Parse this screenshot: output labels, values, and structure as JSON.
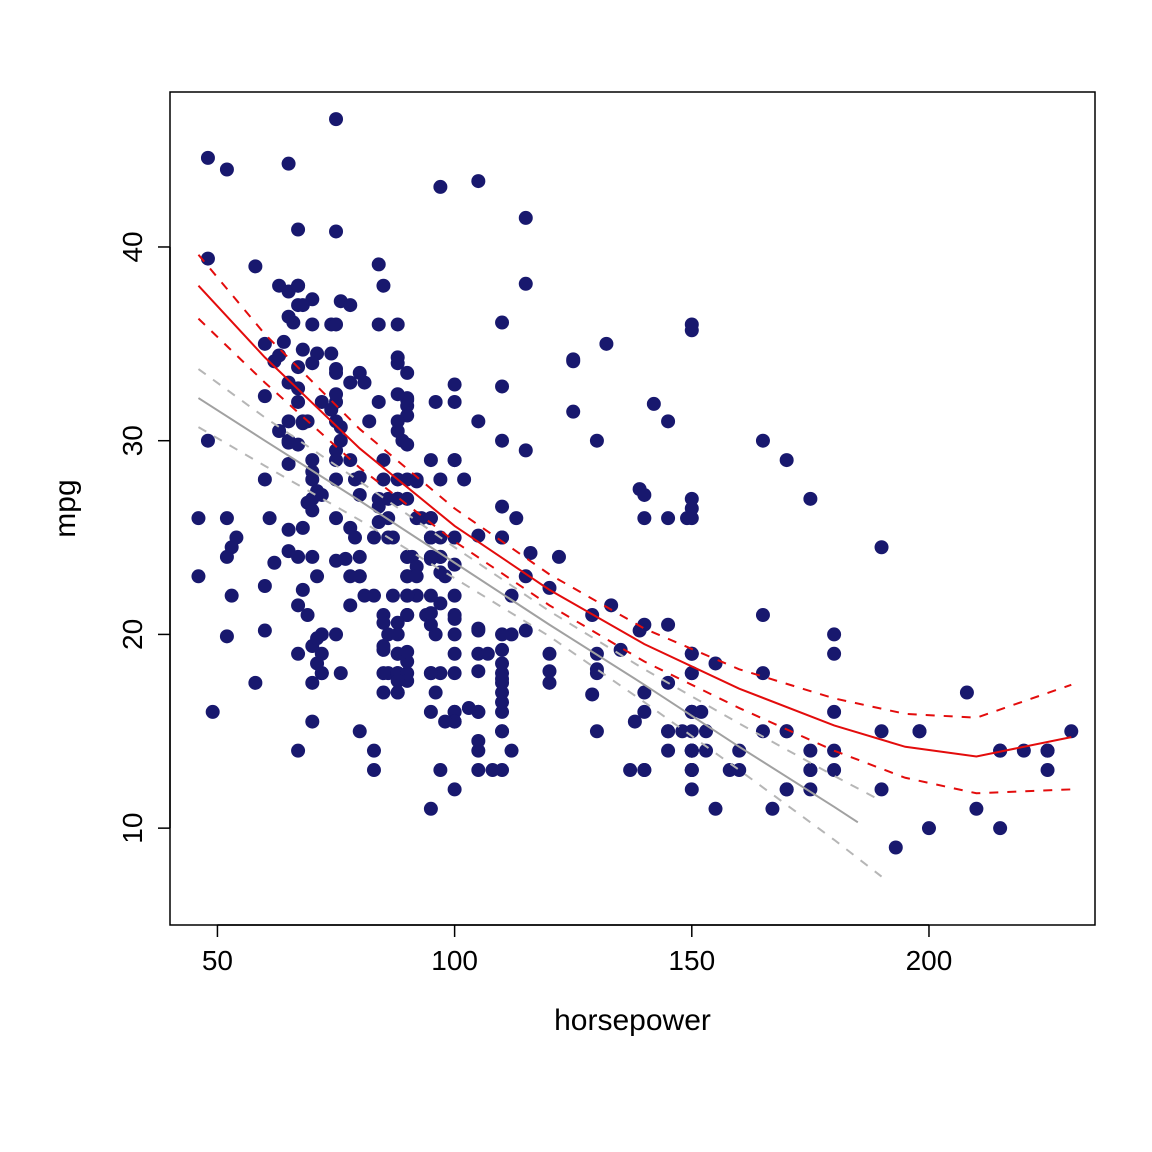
{
  "chart_data": {
    "type": "scatter",
    "title": "",
    "xlabel": "horsepower",
    "ylabel": "mpg",
    "xlim": [
      40,
      235
    ],
    "ylim": [
      5,
      48
    ],
    "x_ticks": [
      50,
      100,
      150,
      200
    ],
    "y_ticks": [
      10,
      20,
      30,
      40
    ],
    "point_color": "#18186e",
    "point_radius": 7,
    "scatter": {
      "x": [
        130,
        165,
        150,
        150,
        140,
        198,
        220,
        215,
        225,
        190,
        170,
        160,
        150,
        225,
        95,
        95,
        97,
        85,
        88,
        46,
        87,
        90,
        95,
        113,
        90,
        215,
        200,
        210,
        193,
        88,
        90,
        95,
        100,
        105,
        100,
        88,
        100,
        165,
        175,
        153,
        150,
        180,
        170,
        175,
        110,
        72,
        100,
        88,
        86,
        90,
        70,
        76,
        65,
        69,
        60,
        70,
        95,
        80,
        54,
        90,
        86,
        165,
        175,
        150,
        153,
        150,
        208,
        155,
        160,
        190,
        97,
        150,
        130,
        140,
        150,
        112,
        76,
        87,
        69,
        86,
        92,
        97,
        80,
        88,
        175,
        150,
        145,
        137,
        150,
        198,
        150,
        158,
        150,
        215,
        225,
        175,
        105,
        100,
        100,
        88,
        95,
        46,
        150,
        167,
        170,
        180,
        100,
        88,
        72,
        94,
        90,
        85,
        107,
        90,
        145,
        230,
        49,
        75,
        91,
        112,
        150,
        110,
        122,
        180,
        95,
        100,
        100,
        67,
        80,
        65,
        75,
        100,
        110,
        105,
        140,
        150,
        150,
        140,
        150,
        83,
        67,
        78,
        52,
        61,
        75,
        75,
        75,
        97,
        93,
        67,
        95,
        105,
        72,
        72,
        170,
        145,
        150,
        148,
        110,
        105,
        110,
        95,
        110,
        110,
        129,
        75,
        83,
        100,
        78,
        96,
        71,
        97,
        97,
        70,
        90,
        95,
        88,
        98,
        115,
        53,
        86,
        81,
        92,
        79,
        83,
        140,
        150,
        120,
        152,
        100,
        105,
        81,
        90,
        52,
        60,
        70,
        53,
        100,
        78,
        110,
        95,
        71,
        70,
        75,
        72,
        102,
        150,
        88,
        108,
        120,
        180,
        145,
        130,
        150,
        68,
        80,
        58,
        96,
        70,
        145,
        110,
        145,
        130,
        110,
        105,
        100,
        98,
        180,
        170,
        190,
        149,
        78,
        88,
        75,
        89,
        63,
        83,
        67,
        78,
        97,
        110,
        110,
        48,
        66,
        52,
        70,
        60,
        110,
        140,
        139,
        105,
        95,
        85,
        88,
        100,
        90,
        105,
        85,
        110,
        120,
        145,
        165,
        139,
        140,
        68,
        95,
        97,
        75,
        95,
        105,
        85,
        97,
        103,
        125,
        115,
        133,
        71,
        68,
        115,
        85,
        88,
        90,
        110,
        130,
        129,
        138,
        135,
        155,
        142,
        125,
        150,
        71,
        65,
        80,
        80,
        77,
        125,
        71,
        90,
        70,
        70,
        65,
        69,
        90,
        115,
        115,
        90,
        76,
        60,
        70,
        65,
        90,
        88,
        90,
        90,
        78,
        90,
        75,
        92,
        75,
        65,
        105,
        65,
        48,
        48,
        67,
        67,
        67,
        67,
        62,
        132,
        100,
        88,
        72,
        84,
        84,
        92,
        110,
        84,
        58,
        64,
        60,
        67,
        65,
        62,
        68,
        63,
        65,
        65,
        74,
        75,
        75,
        100,
        74,
        80,
        76,
        116,
        120,
        110,
        105,
        88,
        85,
        88,
        88,
        88,
        85,
        84,
        90,
        92,
        74,
        68,
        68,
        63,
        70,
        88,
        75,
        70,
        67,
        67,
        67,
        110,
        85,
        92,
        112,
        96,
        84,
        90,
        86,
        52,
        84,
        79,
        82
      ],
      "y": [
        18,
        15,
        18,
        16,
        17,
        15,
        14,
        14,
        14,
        15,
        15,
        14,
        15,
        14,
        24,
        22,
        18,
        21,
        27,
        26,
        25,
        24,
        25,
        26,
        21,
        10,
        10,
        11,
        9,
        27,
        28,
        25,
        25,
        19,
        16,
        17,
        19,
        18,
        14,
        14,
        14,
        14,
        12,
        13,
        13,
        18,
        22,
        19,
        18,
        23,
        28,
        30,
        30,
        31,
        35,
        27,
        26,
        24,
        25,
        23,
        20,
        21,
        13,
        14,
        15,
        14,
        17,
        11,
        13,
        12,
        13,
        19,
        15,
        13,
        13,
        14,
        18,
        22,
        21,
        26,
        22,
        28,
        23,
        28,
        27,
        13,
        14,
        13,
        14,
        15,
        12,
        13,
        13,
        14,
        13,
        12,
        13,
        18,
        16,
        18,
        18,
        23,
        26,
        11,
        12,
        13,
        12,
        18,
        20,
        21,
        22,
        18,
        19,
        21,
        26,
        15,
        16,
        29,
        24,
        20,
        19,
        15,
        24,
        20,
        11,
        20,
        21,
        19,
        15,
        31,
        26,
        32,
        25,
        16,
        16,
        18,
        16,
        13,
        14,
        14,
        14,
        29,
        26,
        26,
        31,
        32,
        28,
        24,
        26,
        24,
        26,
        31,
        19,
        18,
        15,
        15,
        16,
        15,
        16,
        14,
        17,
        16,
        15,
        18,
        21,
        20,
        13,
        29,
        23,
        20,
        23,
        24,
        25,
        24,
        18,
        29,
        19,
        23,
        23,
        22,
        25,
        33,
        28,
        25,
        25,
        26,
        27,
        17.5,
        16,
        15.5,
        14.5,
        22,
        22,
        24,
        22.5,
        29,
        24.5,
        29,
        33,
        20,
        18,
        18.5,
        17.5,
        29.5,
        32,
        28,
        26.5,
        20,
        13,
        19,
        19,
        31,
        30,
        36,
        25.5,
        33.5,
        17.5,
        17,
        15.5,
        15,
        17.5,
        20.5,
        19,
        18.5,
        16,
        15.5,
        15.5,
        16,
        29,
        24.5,
        26,
        25.5,
        30.5,
        33.5,
        30,
        30.5,
        22,
        21.5,
        21.5,
        43.1,
        36.1,
        32.8,
        39.4,
        36.1,
        19.9,
        19.4,
        20.2,
        19.2,
        20.5,
        20.2,
        25.1,
        20.5,
        19.4,
        20.6,
        20.8,
        18.6,
        18.1,
        19.2,
        17.7,
        18.1,
        17.5,
        30,
        27.5,
        27.2,
        30.9,
        21.1,
        23.2,
        23.8,
        23.9,
        20.3,
        17,
        21.6,
        16.2,
        31.5,
        29.5,
        21.5,
        19.8,
        22.3,
        20.2,
        20.6,
        17,
        17.6,
        16.5,
        18.2,
        16.9,
        15.5,
        19.2,
        18.5,
        31.9,
        34.1,
        35.7,
        27.4,
        25.4,
        23,
        27.2,
        23.9,
        34.2,
        34.5,
        31.8,
        37.3,
        28.4,
        28.8,
        26.8,
        33.5,
        41.5,
        38.1,
        32.1,
        37.2,
        28,
        26.4,
        24.3,
        19.1,
        34.3,
        29.8,
        31.3,
        37,
        32.2,
        46.6,
        27.9,
        40.8,
        44.3,
        43.4,
        36.4,
        30,
        44.6,
        40.9,
        33.8,
        29.8,
        32.7,
        23.7,
        35,
        23.6,
        32.4,
        27.2,
        26.6,
        25.8,
        23.5,
        30,
        39.1,
        39,
        35.1,
        32.3,
        37,
        37.7,
        34.1,
        34.7,
        34.4,
        29.9,
        33,
        34.5,
        33.7,
        32.4,
        32.9,
        31.6,
        28.1,
        30.7,
        24.2,
        22.4,
        26.6,
        20.2,
        17.6,
        28,
        27,
        34,
        31,
        29,
        27,
        24,
        23,
        36,
        37,
        31,
        38,
        36,
        36,
        36,
        34,
        38,
        32,
        38,
        25,
        38,
        26,
        22,
        32,
        36,
        27,
        27,
        44,
        32,
        28,
        31
      ]
    },
    "series": [
      {
        "name": "linear-fit",
        "color": "#a1a1a1",
        "style": "solid",
        "x": [
          46,
          60,
          80,
          100,
          120,
          140,
          160,
          180,
          185
        ],
        "y": [
          32.2,
          30.0,
          26.9,
          23.7,
          20.5,
          17.4,
          14.2,
          11.1,
          10.3
        ]
      },
      {
        "name": "linear-ci-upper",
        "color": "#b6b6b6",
        "style": "dashed",
        "x": [
          46,
          60,
          80,
          100,
          120,
          140,
          160,
          180,
          190
        ],
        "y": [
          33.7,
          31.2,
          27.9,
          24.5,
          21.2,
          18.2,
          15.4,
          12.7,
          11.4
        ]
      },
      {
        "name": "linear-ci-lower",
        "color": "#b6b6b6",
        "style": "dashed",
        "x": [
          46,
          60,
          80,
          100,
          120,
          140,
          160,
          180,
          190
        ],
        "y": [
          30.7,
          28.7,
          25.9,
          22.9,
          19.9,
          16.5,
          13.0,
          9.4,
          7.5
        ]
      },
      {
        "name": "quadratic-fit",
        "color": "#e30c0c",
        "style": "solid",
        "x": [
          46,
          60,
          80,
          100,
          120,
          140,
          160,
          180,
          195,
          210,
          230
        ],
        "y": [
          38.0,
          34.3,
          29.6,
          25.6,
          22.3,
          19.5,
          17.2,
          15.3,
          14.2,
          13.7,
          14.7
        ]
      },
      {
        "name": "quadratic-ci-upper",
        "color": "#e30c0c",
        "style": "dashed",
        "x": [
          46,
          60,
          80,
          100,
          120,
          140,
          160,
          180,
          195,
          210,
          230
        ],
        "y": [
          39.6,
          35.5,
          30.6,
          26.5,
          23.1,
          20.3,
          18.2,
          16.7,
          15.9,
          15.7,
          17.4
        ]
      },
      {
        "name": "quadratic-ci-lower",
        "color": "#e30c0c",
        "style": "dashed",
        "x": [
          46,
          60,
          80,
          100,
          120,
          140,
          160,
          180,
          195,
          210,
          230
        ],
        "y": [
          36.3,
          33.0,
          28.6,
          24.8,
          21.5,
          18.6,
          16.2,
          14.0,
          12.6,
          11.8,
          12.0
        ]
      }
    ]
  },
  "labels": {
    "xlabel": "horsepower",
    "ylabel": "mpg"
  }
}
